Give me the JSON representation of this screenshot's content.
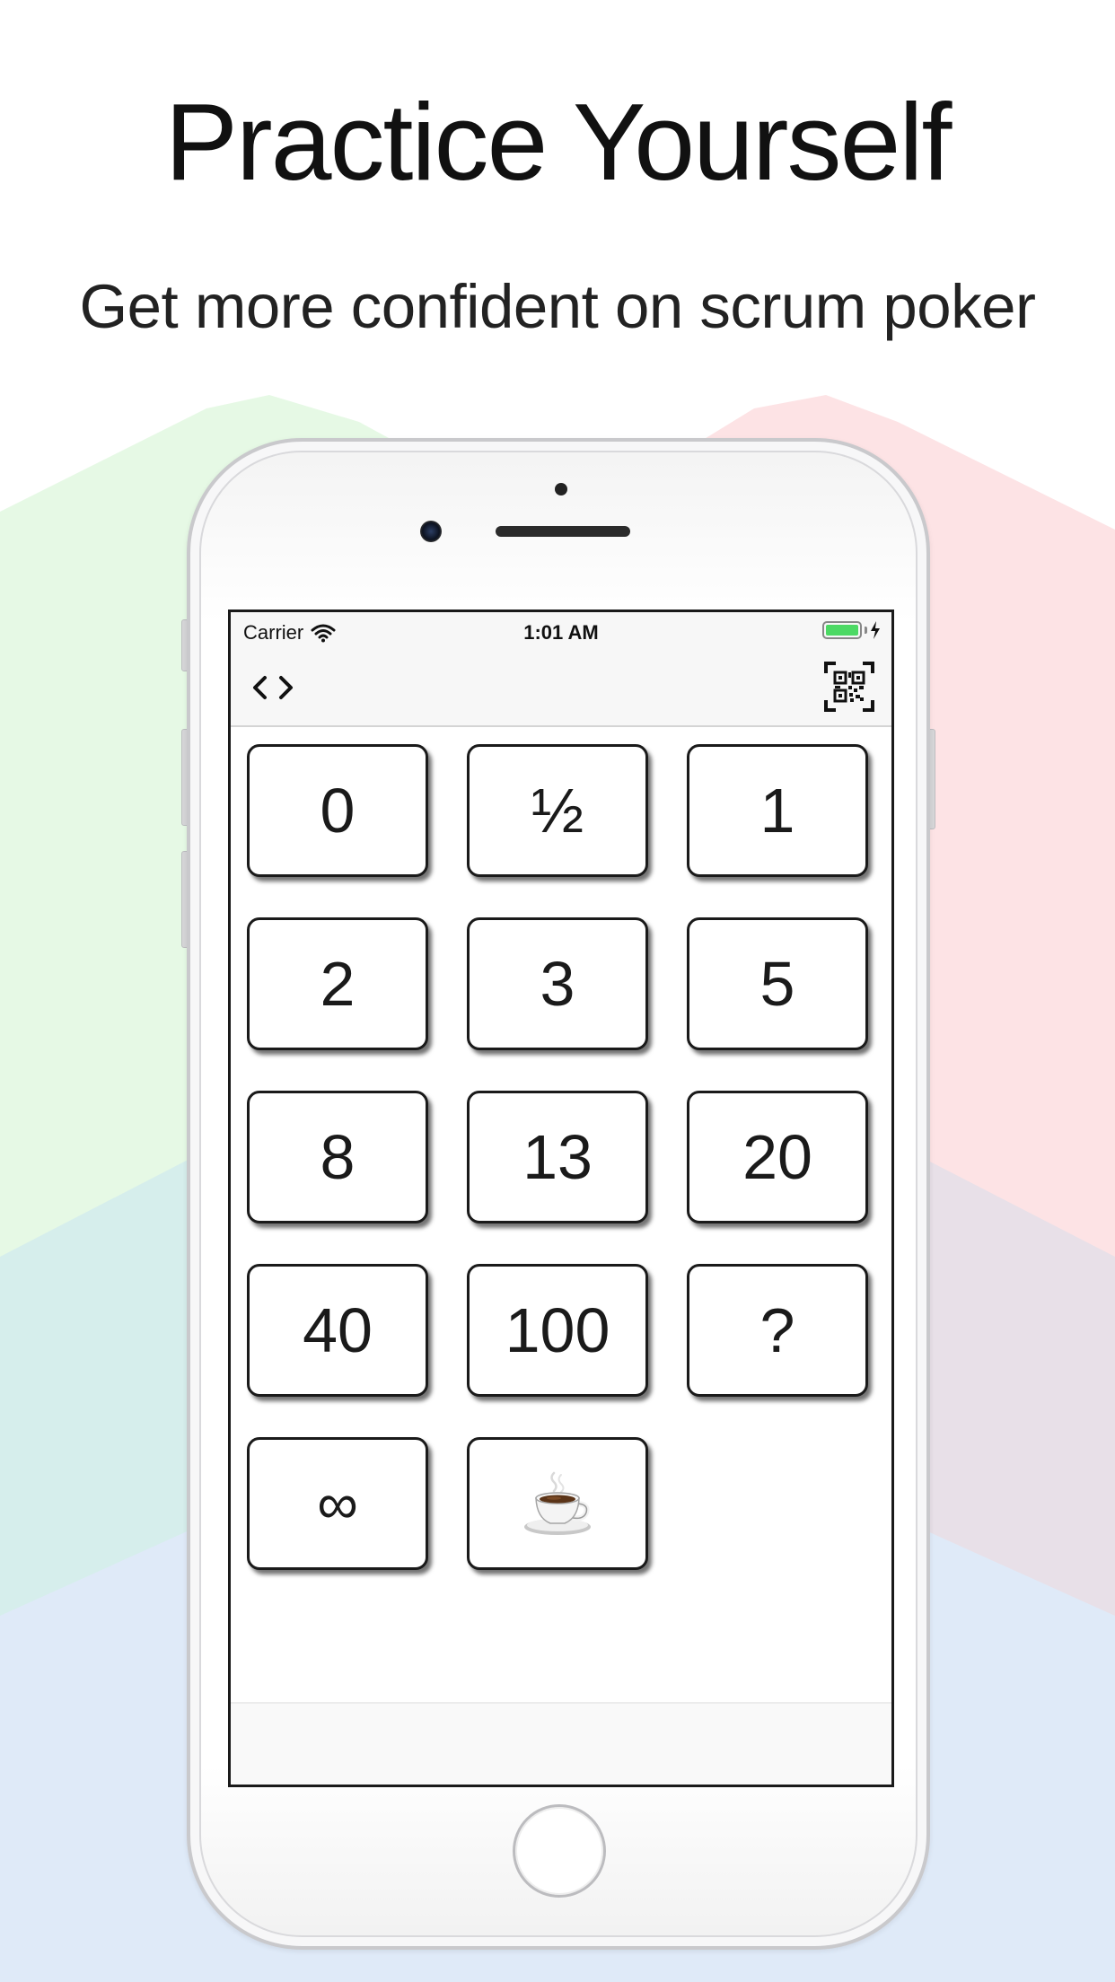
{
  "header": {
    "title": "Practice Yourself",
    "subtitle": "Get more confident on scrum poker"
  },
  "status_bar": {
    "carrier": "Carrier",
    "time": "1:01 AM",
    "battery_level": 1.0
  },
  "nav": {
    "left_icon": "code-brackets-icon",
    "right_icon": "qr-code-icon"
  },
  "cards": [
    {
      "label": "0"
    },
    {
      "label": "½"
    },
    {
      "label": "1"
    },
    {
      "label": "2"
    },
    {
      "label": "3"
    },
    {
      "label": "5"
    },
    {
      "label": "8"
    },
    {
      "label": "13"
    },
    {
      "label": "20"
    },
    {
      "label": "40"
    },
    {
      "label": "100"
    },
    {
      "label": "?"
    },
    {
      "label": "∞"
    },
    {
      "label": "",
      "icon": "coffee-cup-icon"
    }
  ],
  "colors": {
    "bg_green": "#e4f9e4",
    "bg_red": "#fde2e4",
    "bg_teal": "#d7efee",
    "bg_blue": "#dfeaf9",
    "battery": "#4cd964"
  }
}
